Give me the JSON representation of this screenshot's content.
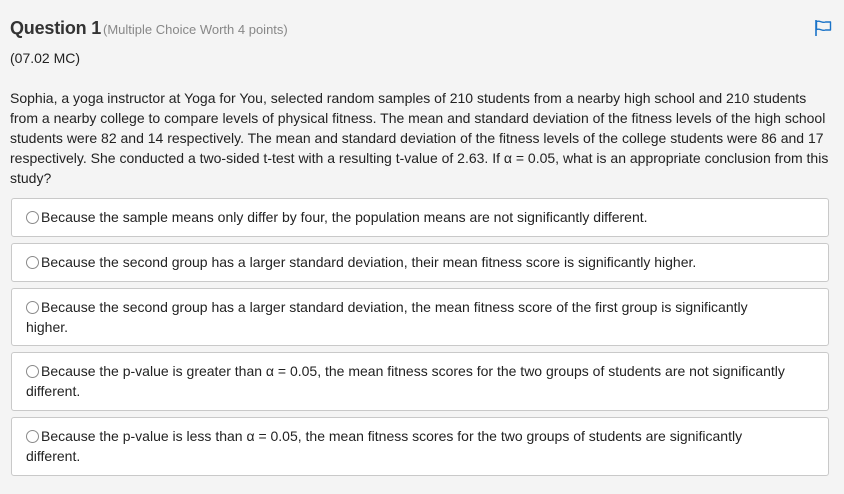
{
  "question": {
    "title": "Question 1",
    "worth": "(Multiple Choice Worth 4 points)",
    "code": "(07.02 MC)",
    "stem": "Sophia, a yoga instructor at Yoga for You, selected random samples of 210 students from a nearby high school and 210 students from a nearby college to compare levels of physical fitness. The mean and standard deviation of the fitness levels of the high school students were 82 and 14 respectively. The mean and standard deviation of the fitness levels of the college students were 86 and 17 respectively. She conducted a two-sided t-test with a resulting t-value of 2.63. If α = 0.05, what is an appropriate conclusion from this study?",
    "flag_icon": "flag-icon",
    "accent_color": "#1a73c8"
  },
  "choices": [
    {
      "label": "Because the sample means only differ by four, the population means are not significantly different."
    },
    {
      "label": "Because the second group has a larger standard deviation, their mean fitness score is significantly higher."
    },
    {
      "label": "Because the second group has a larger standard deviation, the mean fitness score of the first group is significantly higher."
    },
    {
      "label": "Because the p-value is greater than α = 0.05, the mean fitness scores for the two groups of students are not significantly different."
    },
    {
      "label": "Because the p-value is less than α = 0.05, the mean fitness scores for the two groups of students are significantly different."
    }
  ]
}
